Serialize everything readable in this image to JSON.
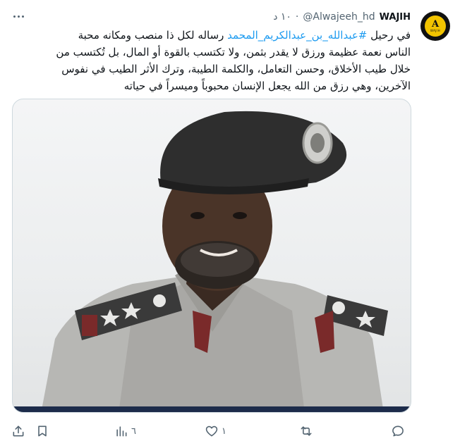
{
  "tweet": {
    "author_name": "WAJIH",
    "handle": "@Alwajeeh_hd",
    "separator": "·",
    "time": "١٠ د",
    "avatar_letter": "A",
    "avatar_caption": "WAJIH",
    "body_lines": [
      {
        "pre": "في رحيل ",
        "tag": "#عبدالله_بن_عبدالكريم_المحمد",
        "post": " رساله لكل ذا منصب ومكانه محبة"
      },
      {
        "pre": "الناس نعمة عظيمة ورزق لا يقدر بثمن، ولا تكتسب بالقوة أو المال، بل تُكتسب من",
        "tag": "",
        "post": ""
      },
      {
        "pre": "خلال طيب الأخلاق، وحسن التعامل، والكلمة الطيبة، وترك الأثر الطيب في نفوس",
        "tag": "",
        "post": ""
      },
      {
        "pre": "الآخرين، وهي رزق من الله يجعل الإنسان محبوباً وميسراً في حياته",
        "tag": "",
        "post": ""
      }
    ]
  },
  "actions": {
    "views_count": "٦",
    "likes_count": "١"
  },
  "colors": {
    "link": "#1d9bf0",
    "muted": "#536471",
    "accent_avatar": "#f2c400",
    "media_bar": "#1c2b4a"
  },
  "icons": {
    "more": "more-horizontal-icon",
    "share": "share-icon",
    "bookmark": "bookmark-icon",
    "views": "views-chart-icon",
    "like": "heart-icon",
    "retweet": "retweet-icon",
    "reply": "reply-icon"
  }
}
